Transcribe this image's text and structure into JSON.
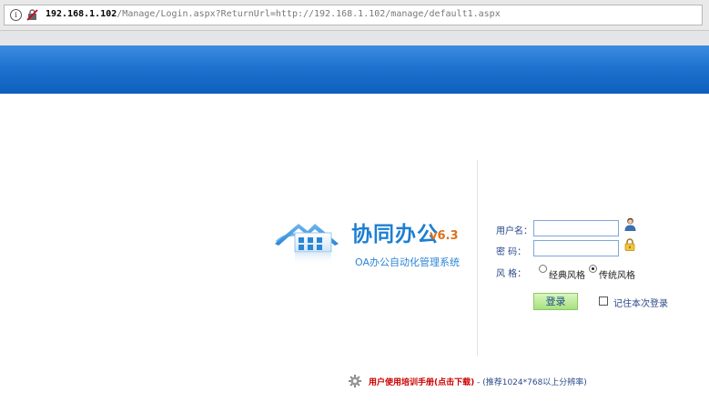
{
  "browser": {
    "url_host": "192.168.1.102",
    "url_path": "/Manage/Login.aspx?ReturnUrl=http://192.168.1.102/manage/default1.aspx"
  },
  "logo": {
    "brand": "协同办公",
    "version": "v6.3",
    "subtitle": "OA办公自动化管理系统"
  },
  "login_form": {
    "username_label": "用户名：",
    "username_value": "",
    "password_label": "密  码：",
    "password_value": "",
    "style_label": "风  格：",
    "style_options": [
      "经典风格",
      "传统风格"
    ],
    "style_selected": "传统风格",
    "login_button": "登录",
    "remember_label": "记住本次登录",
    "remember_checked": false
  },
  "footer": {
    "manual_link": "用户使用培训手册(点击下载)",
    "manual_note": " - (推荐1024*768以上分辨率)"
  },
  "colors": {
    "banner_blue": "#1f73cf",
    "brand_blue": "#1c7fd3",
    "version_orange": "#e0701c",
    "label_blue": "#2a4a8a",
    "link_red": "#cc0000",
    "button_green": "#a8e07e"
  }
}
